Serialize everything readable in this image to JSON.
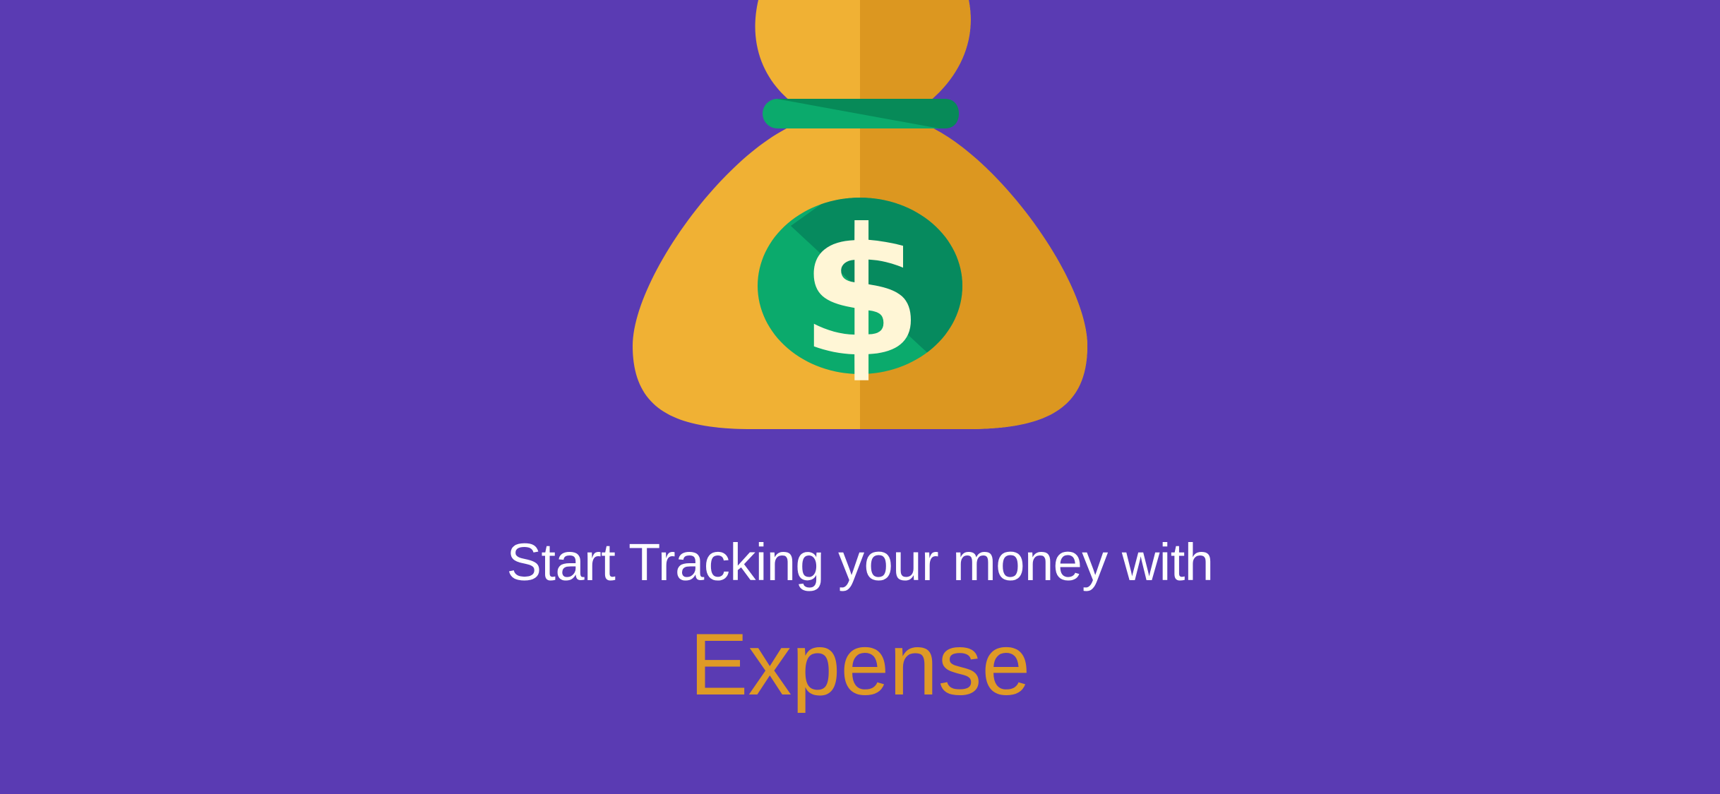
{
  "screen": {
    "background_color": "#5A3BB3"
  },
  "illustration": {
    "icon": "money-bag-icon",
    "bag_light_color": "#F0B134",
    "bag_shade_color": "#DC9720",
    "tie_color": "#0BAA6C",
    "tie_shade_color": "#078A58",
    "badge_color": "#0BAA6C",
    "badge_shade_color": "#068A5E",
    "symbol_glyph": "$",
    "symbol_color": "#FFF6D6",
    "symbol_shade_color": "#F5E2B0"
  },
  "welcome": {
    "tagline": "Start Tracking your money with",
    "tagline_color": "#FFFFFF",
    "app_name": "Expense",
    "app_name_color": "#DF9A26"
  }
}
